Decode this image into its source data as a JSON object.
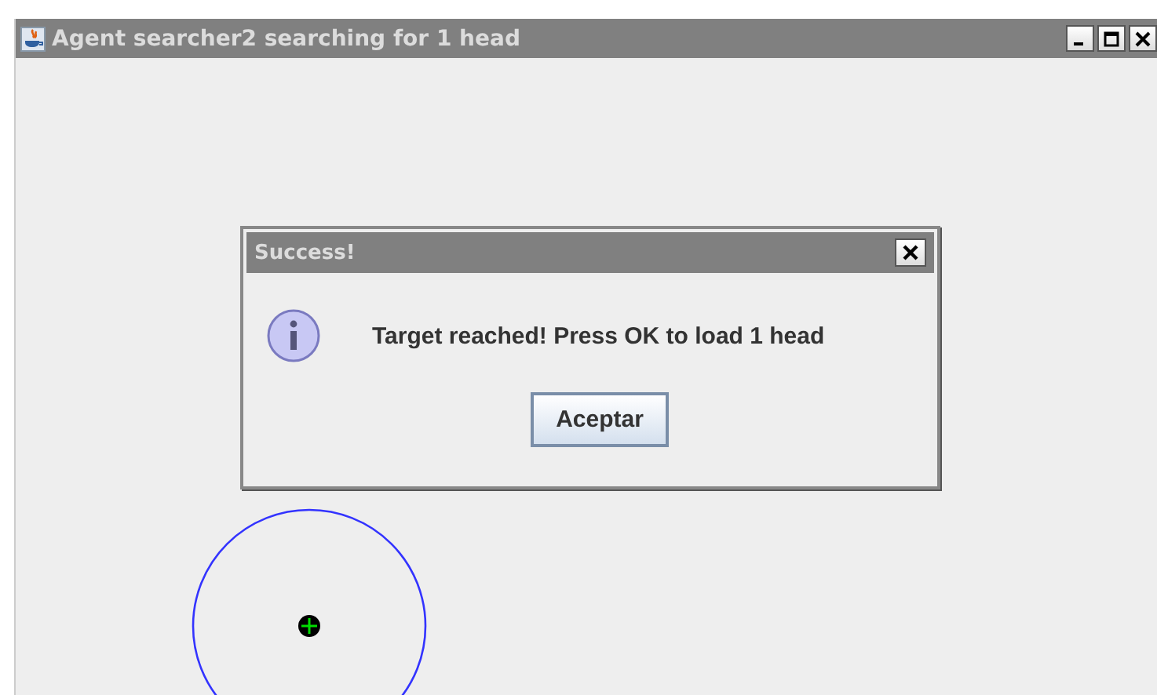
{
  "window": {
    "title": "Agent searcher2 searching for 1 head"
  },
  "dialog": {
    "title": "Success!",
    "message": "Target reached! Press OK to load **1** head",
    "buttons": [
      "Aceptar"
    ]
  }
}
